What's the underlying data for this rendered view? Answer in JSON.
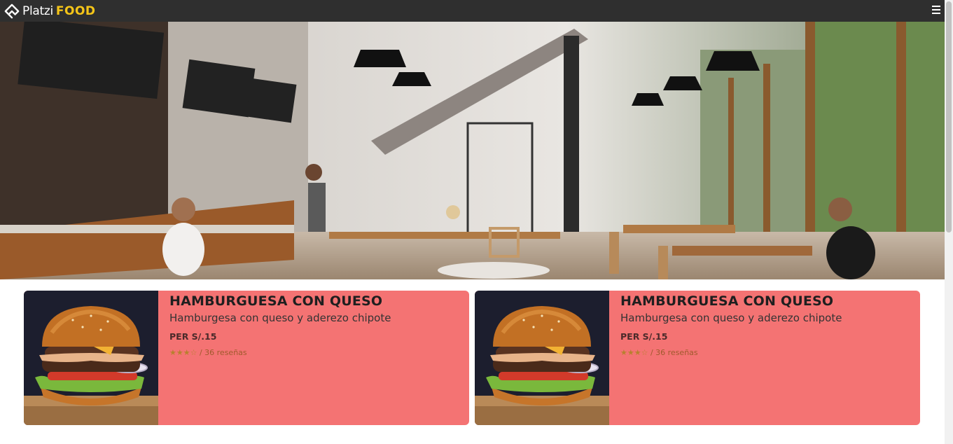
{
  "header": {
    "brand_first": "Platzi",
    "brand_second": "FOOD",
    "logo_icon": "platzi-logo-icon",
    "menu_icon": "hamburger-menu-icon"
  },
  "hero": {
    "image_subject": "restaurant-interior-photo"
  },
  "colors": {
    "header_bg": "#2f2f2f",
    "brand_accent": "#f5c518",
    "card_bg": "#f47373"
  },
  "cards": [
    {
      "title": "HAMBURGUESA CON QUESO",
      "description": "Hamburgesa con queso y aderezo chipote",
      "price": "PER S/.15",
      "stars": "★★★☆",
      "rating_value": 3,
      "rating_max": 4,
      "reviews": "/ 36 reseñas",
      "image_icon": "cheeseburger-image"
    },
    {
      "title": "HAMBURGUESA CON QUESO",
      "description": "Hamburgesa con queso y aderezo chipote",
      "price": "PER S/.15",
      "stars": "★★★☆",
      "rating_value": 3,
      "rating_max": 4,
      "reviews": "/ 36 reseñas",
      "image_icon": "cheeseburger-image"
    }
  ]
}
